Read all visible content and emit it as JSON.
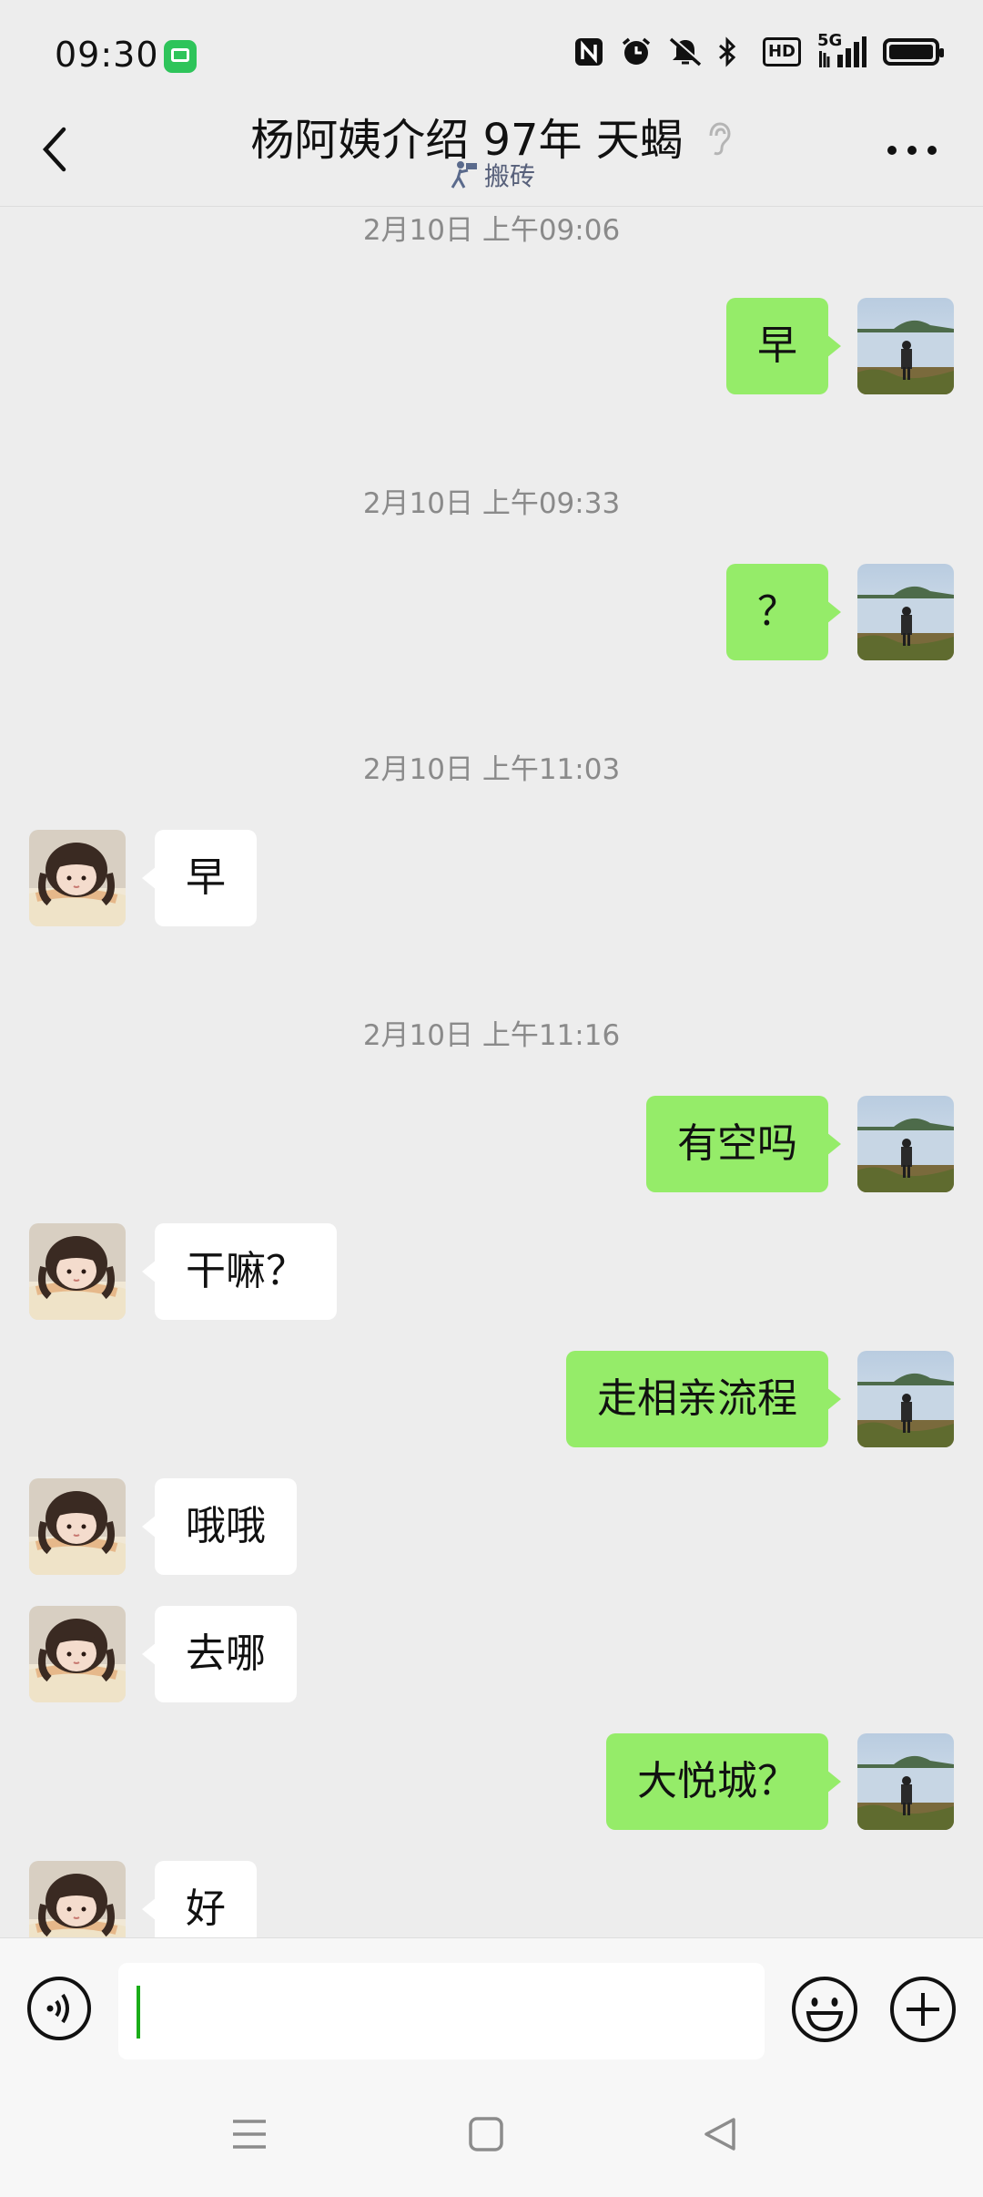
{
  "status_bar": {
    "time": "09:30",
    "icons": [
      "wechat-notification-icon",
      "nfc-icon",
      "alarm-icon",
      "mute-icon",
      "bluetooth-icon",
      "hd-icon",
      "signal-5g-icon",
      "battery-icon"
    ],
    "hd_label": "HD",
    "network_label": "5G"
  },
  "header": {
    "title": "杨阿姨介绍 97年 天蝎",
    "subtitle": "搬砖",
    "back_icon": "chevron-left-icon",
    "more_icon": "more-dots-icon",
    "ear_icon": "earpiece-mode-icon"
  },
  "messages": [
    {
      "type": "time",
      "text": "2月10日 上午09:06"
    },
    {
      "type": "msg",
      "side": "out",
      "text": "早"
    },
    {
      "type": "time",
      "text": "2月10日 上午09:33"
    },
    {
      "type": "msg",
      "side": "out",
      "text": "？"
    },
    {
      "type": "time",
      "text": "2月10日 上午11:03"
    },
    {
      "type": "msg",
      "side": "in",
      "text": "早"
    },
    {
      "type": "time",
      "text": "2月10日 上午11:16"
    },
    {
      "type": "msg",
      "side": "out",
      "text": "有空吗"
    },
    {
      "type": "msg",
      "side": "in",
      "text": "干嘛？"
    },
    {
      "type": "msg",
      "side": "out",
      "text": "走相亲流程"
    },
    {
      "type": "msg",
      "side": "in",
      "text": "哦哦"
    },
    {
      "type": "msg",
      "side": "in",
      "text": "去哪"
    },
    {
      "type": "msg",
      "side": "out",
      "text": "大悦城？"
    },
    {
      "type": "msg",
      "side": "in",
      "text": "好"
    }
  ],
  "input_bar": {
    "placeholder": "",
    "value": "",
    "voice_icon": "voice-input-icon",
    "emoji_icon": "emoji-icon",
    "plus_icon": "plus-icon"
  },
  "nav_bar": {
    "icons": [
      "menu-icon",
      "home-icon",
      "back-triangle-icon"
    ]
  },
  "colors": {
    "background": "#ededed",
    "outgoing_bubble": "#95ec69",
    "incoming_bubble": "#ffffff",
    "timestamp": "#8a8a8a",
    "cursor": "#1aad19"
  }
}
